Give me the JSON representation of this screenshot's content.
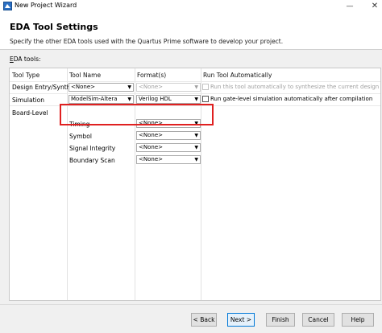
{
  "window": {
    "title": "New Project Wizard",
    "minimize_glyph": "—",
    "close_glyph": "✕"
  },
  "header": {
    "title": "EDA Tool Settings",
    "description": "Specify the other EDA tools used with the Quartus Prime software to develop your project."
  },
  "eda_tools_label": {
    "first": "E",
    "rest": "DA tools:"
  },
  "table": {
    "headers": {
      "tool_type": "Tool Type",
      "tool_name": "Tool Name",
      "format": "Format(s)",
      "run": "Run Tool Automatically"
    },
    "design_entry": {
      "type": "Design Entry/Synth",
      "tool": "<None>",
      "format": "<None>",
      "run_checked": false,
      "run_text": "Run this tool automatically to synthesize the current design"
    },
    "simulation": {
      "type": "Simulation",
      "tool": "ModelSim-Altera",
      "format": "Verilog HDL",
      "run_checked": false,
      "run_text": "Run gate-level simulation automatically after compilation"
    },
    "board_level": {
      "type": "Board-Level",
      "rows": [
        {
          "tool": "Timing",
          "format": "<None>"
        },
        {
          "tool": "Symbol",
          "format": "<None>"
        },
        {
          "tool": "Signal Integrity",
          "format": "<None>"
        },
        {
          "tool": "Boundary Scan",
          "format": "<None>"
        }
      ]
    }
  },
  "buttons": {
    "back": "< Back",
    "next": "Next >",
    "finish": "Finish",
    "cancel": "Cancel",
    "help": "Help"
  },
  "colors": {
    "highlight": "#e02020",
    "primary_border": "#0078d7"
  }
}
